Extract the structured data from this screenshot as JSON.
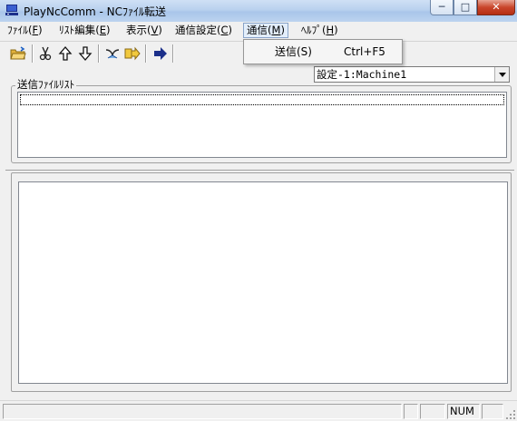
{
  "window": {
    "title": "PlayNcComm - NCﾌｧｲﾙ転送",
    "controls": {
      "minimize": "─",
      "maximize": "□",
      "close": "✕"
    }
  },
  "menubar": {
    "items": [
      {
        "pre": "ﾌｧｲﾙ(",
        "key": "F",
        "post": ")"
      },
      {
        "pre": "ﾘｽﾄ編集(",
        "key": "E",
        "post": ")"
      },
      {
        "pre": "表示(",
        "key": "V",
        "post": ")"
      },
      {
        "pre": "通信設定(",
        "key": "C",
        "post": ")"
      },
      {
        "pre": "通信(",
        "key": "M",
        "post": ")"
      },
      {
        "pre": "ﾍﾙﾌﾟ(",
        "key": "H",
        "post": ")"
      }
    ]
  },
  "toolbar": {
    "icons": [
      "open-folder-icon",
      "cut-icon",
      "move-up-icon",
      "move-down-icon",
      "reload-icon",
      "send-to-icon",
      "transfer-arrow-icon"
    ]
  },
  "dropdown": {
    "items": [
      {
        "label": "送信(S)",
        "shortcut": "Ctrl+F5"
      }
    ]
  },
  "machine_select": {
    "value": "設定-1:Machine1"
  },
  "file_list": {
    "group_label": "送信ﾌｧｲﾙﾘｽﾄ"
  },
  "statusbar": {
    "num_indicator": "NUM"
  }
}
